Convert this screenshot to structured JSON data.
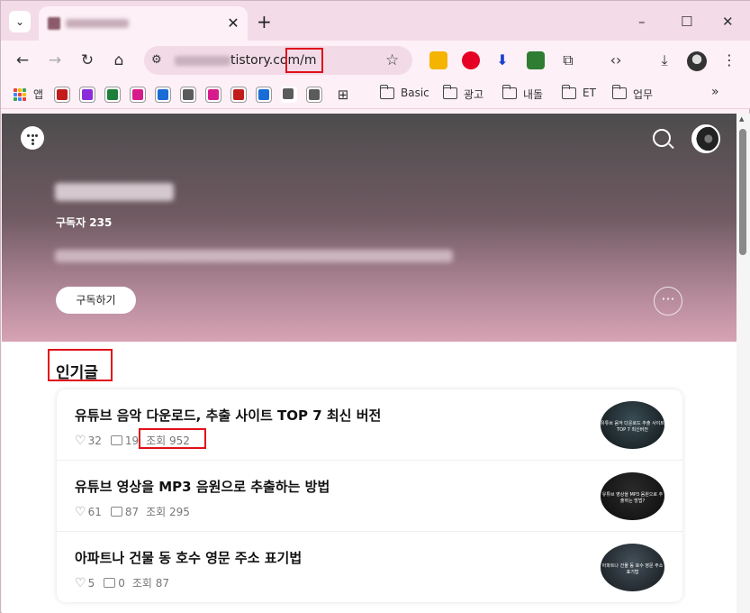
{
  "browser": {
    "tab_close": "✕",
    "new_tab": "+",
    "url_visible": "tistory.com/m",
    "window_controls": [
      "–",
      "☐",
      "✕"
    ]
  },
  "bookmarks": {
    "apps_label": "앱",
    "folders": [
      "Basic",
      "광고",
      "내돌",
      "ET",
      "업무"
    ],
    "overflow": "»",
    "square_colors": [
      "#c21b1b",
      "#8c2bd9",
      "#1e7f3a",
      "#d81b8c",
      "#1a6dd6",
      "#5b5b5b",
      "#d81b8c",
      "#c21b1b",
      "#1a6dd6",
      "#5b5b5b",
      "#5b5b5b"
    ]
  },
  "blog": {
    "subscribers": "구독자 235",
    "subscribe_button": "구독하기",
    "more_button": "···"
  },
  "popular": {
    "title": "인기글",
    "posts": [
      {
        "title": "유튜브 음악 다운로드, 추출 사이트 TOP 7 최신 버전",
        "likes": "32",
        "comments": "19",
        "views": "조회 952",
        "thumb": "유튜브 음악 다운로드 추출 사이트 TOP 7 최신버전"
      },
      {
        "title": "유튜브 영상을 MP3 음원으로 추출하는 방법",
        "likes": "61",
        "comments": "87",
        "views": "조회 295",
        "thumb": "유튜브 영상을 MP3 음원으로 추출하는 방법?"
      },
      {
        "title": "아파트나 건물 동 호수 영문 주소 표기법",
        "likes": "5",
        "comments": "0",
        "views": "조회 87",
        "thumb": "아파트나 건물 동 호수 영문 주소 표기법"
      }
    ]
  }
}
